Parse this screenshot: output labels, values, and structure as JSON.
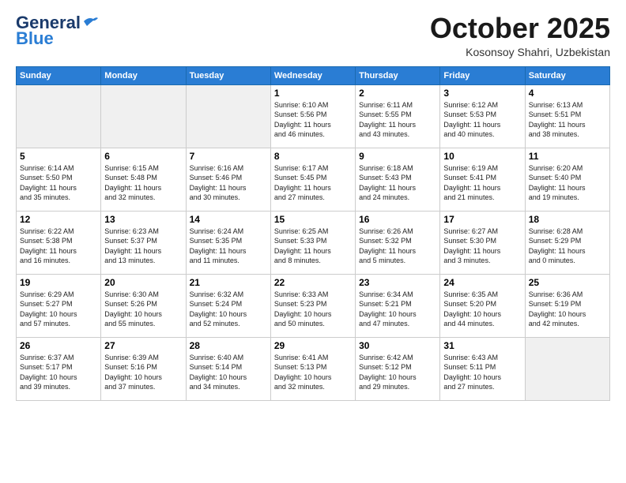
{
  "logo": {
    "line1": "General",
    "line2": "Blue"
  },
  "header": {
    "month": "October 2025",
    "location": "Kosonsoy Shahri, Uzbekistan"
  },
  "days_of_week": [
    "Sunday",
    "Monday",
    "Tuesday",
    "Wednesday",
    "Thursday",
    "Friday",
    "Saturday"
  ],
  "weeks": [
    [
      {
        "day": "",
        "info": ""
      },
      {
        "day": "",
        "info": ""
      },
      {
        "day": "",
        "info": ""
      },
      {
        "day": "1",
        "info": "Sunrise: 6:10 AM\nSunset: 5:56 PM\nDaylight: 11 hours\nand 46 minutes."
      },
      {
        "day": "2",
        "info": "Sunrise: 6:11 AM\nSunset: 5:55 PM\nDaylight: 11 hours\nand 43 minutes."
      },
      {
        "day": "3",
        "info": "Sunrise: 6:12 AM\nSunset: 5:53 PM\nDaylight: 11 hours\nand 40 minutes."
      },
      {
        "day": "4",
        "info": "Sunrise: 6:13 AM\nSunset: 5:51 PM\nDaylight: 11 hours\nand 38 minutes."
      }
    ],
    [
      {
        "day": "5",
        "info": "Sunrise: 6:14 AM\nSunset: 5:50 PM\nDaylight: 11 hours\nand 35 minutes."
      },
      {
        "day": "6",
        "info": "Sunrise: 6:15 AM\nSunset: 5:48 PM\nDaylight: 11 hours\nand 32 minutes."
      },
      {
        "day": "7",
        "info": "Sunrise: 6:16 AM\nSunset: 5:46 PM\nDaylight: 11 hours\nand 30 minutes."
      },
      {
        "day": "8",
        "info": "Sunrise: 6:17 AM\nSunset: 5:45 PM\nDaylight: 11 hours\nand 27 minutes."
      },
      {
        "day": "9",
        "info": "Sunrise: 6:18 AM\nSunset: 5:43 PM\nDaylight: 11 hours\nand 24 minutes."
      },
      {
        "day": "10",
        "info": "Sunrise: 6:19 AM\nSunset: 5:41 PM\nDaylight: 11 hours\nand 21 minutes."
      },
      {
        "day": "11",
        "info": "Sunrise: 6:20 AM\nSunset: 5:40 PM\nDaylight: 11 hours\nand 19 minutes."
      }
    ],
    [
      {
        "day": "12",
        "info": "Sunrise: 6:22 AM\nSunset: 5:38 PM\nDaylight: 11 hours\nand 16 minutes."
      },
      {
        "day": "13",
        "info": "Sunrise: 6:23 AM\nSunset: 5:37 PM\nDaylight: 11 hours\nand 13 minutes."
      },
      {
        "day": "14",
        "info": "Sunrise: 6:24 AM\nSunset: 5:35 PM\nDaylight: 11 hours\nand 11 minutes."
      },
      {
        "day": "15",
        "info": "Sunrise: 6:25 AM\nSunset: 5:33 PM\nDaylight: 11 hours\nand 8 minutes."
      },
      {
        "day": "16",
        "info": "Sunrise: 6:26 AM\nSunset: 5:32 PM\nDaylight: 11 hours\nand 5 minutes."
      },
      {
        "day": "17",
        "info": "Sunrise: 6:27 AM\nSunset: 5:30 PM\nDaylight: 11 hours\nand 3 minutes."
      },
      {
        "day": "18",
        "info": "Sunrise: 6:28 AM\nSunset: 5:29 PM\nDaylight: 11 hours\nand 0 minutes."
      }
    ],
    [
      {
        "day": "19",
        "info": "Sunrise: 6:29 AM\nSunset: 5:27 PM\nDaylight: 10 hours\nand 57 minutes."
      },
      {
        "day": "20",
        "info": "Sunrise: 6:30 AM\nSunset: 5:26 PM\nDaylight: 10 hours\nand 55 minutes."
      },
      {
        "day": "21",
        "info": "Sunrise: 6:32 AM\nSunset: 5:24 PM\nDaylight: 10 hours\nand 52 minutes."
      },
      {
        "day": "22",
        "info": "Sunrise: 6:33 AM\nSunset: 5:23 PM\nDaylight: 10 hours\nand 50 minutes."
      },
      {
        "day": "23",
        "info": "Sunrise: 6:34 AM\nSunset: 5:21 PM\nDaylight: 10 hours\nand 47 minutes."
      },
      {
        "day": "24",
        "info": "Sunrise: 6:35 AM\nSunset: 5:20 PM\nDaylight: 10 hours\nand 44 minutes."
      },
      {
        "day": "25",
        "info": "Sunrise: 6:36 AM\nSunset: 5:19 PM\nDaylight: 10 hours\nand 42 minutes."
      }
    ],
    [
      {
        "day": "26",
        "info": "Sunrise: 6:37 AM\nSunset: 5:17 PM\nDaylight: 10 hours\nand 39 minutes."
      },
      {
        "day": "27",
        "info": "Sunrise: 6:39 AM\nSunset: 5:16 PM\nDaylight: 10 hours\nand 37 minutes."
      },
      {
        "day": "28",
        "info": "Sunrise: 6:40 AM\nSunset: 5:14 PM\nDaylight: 10 hours\nand 34 minutes."
      },
      {
        "day": "29",
        "info": "Sunrise: 6:41 AM\nSunset: 5:13 PM\nDaylight: 10 hours\nand 32 minutes."
      },
      {
        "day": "30",
        "info": "Sunrise: 6:42 AM\nSunset: 5:12 PM\nDaylight: 10 hours\nand 29 minutes."
      },
      {
        "day": "31",
        "info": "Sunrise: 6:43 AM\nSunset: 5:11 PM\nDaylight: 10 hours\nand 27 minutes."
      },
      {
        "day": "",
        "info": ""
      }
    ]
  ]
}
